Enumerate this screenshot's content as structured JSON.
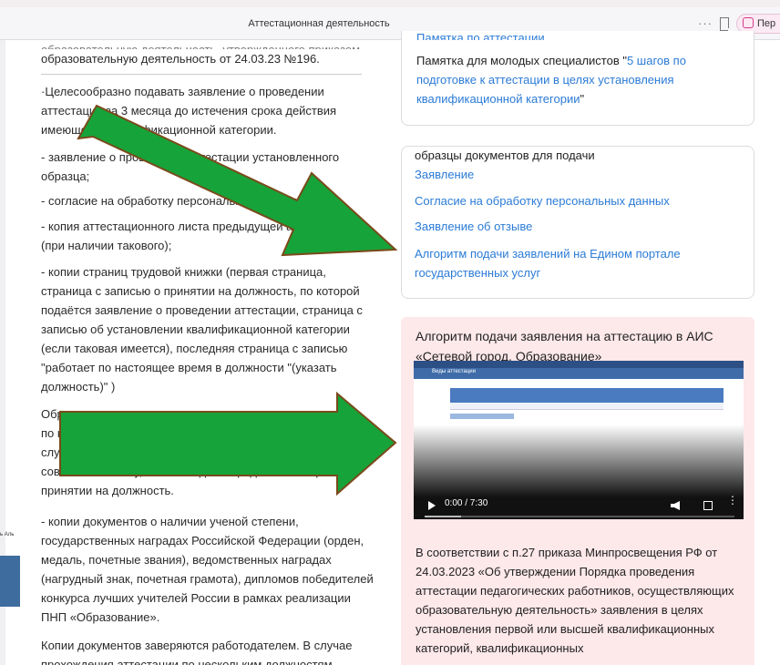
{
  "topbar": {
    "title": "Аттестационная деятельность",
    "menu": "···",
    "ext_label": "Пер"
  },
  "behind": {
    "text": "ь Аль"
  },
  "left": {
    "top_partial": "образовательную деятельность, утвержденного приказом",
    "order_line": "образовательную деятельность от 24.03.23 №196.",
    "para1": "·Целесообразно подавать заявление о проведении аттестации за 3 месяца до истечения срока действия имеющейся квалификационной категории.",
    "para2": "- заявление о проведении аттестации установленного образца;",
    "para3": "- согласие на обработку персональных данных;",
    "para4": "- копия аттестационного листа предыдущей аттестации (при наличии такового);",
    "para5": "- копии страниц трудовой книжки (первая страница, страница с записью о принятии на должность, по которой подаётся заявление о проведении аттестации, страница с записью об установлении квалификационной категории (если таковая имеется), последняя страница с записью \"работает по настоящее время в должности \"(указать должность)\" )",
    "para6": "Обратите внимание, занимаемая должность и должность по которой подаётся заявление должны совпадать. В случае, если Вы работаете по должности по совместительству, то необходимо предоставить приказ о принятии на должность.",
    "para7": "- копии документов о наличии ученой степени, государственных наградах Российской Федерации (орден, медаль, почетные звания), ведомственных наградах (нагрудный знак, почетная грамота), дипломов победителей конкурса лучших учителей России в рамках реализации ПНП «Образование».",
    "para8": "Копии документов заверяются работодателем. В случае прохождения аттестации по нескольким должностям"
  },
  "card1": {
    "partial": "Памятка по аттестации",
    "text_prefix": "Памятка для молодых специалистов \"",
    "link": "5 шагов по подготовке к аттестации в целях установления квалификационной категории",
    "text_suffix": "\""
  },
  "card2": {
    "heading": "образцы документов для подачи",
    "items": [
      "Заявление",
      "Согласие на обработку персональных данных",
      "Заявление об отзыве",
      "Алгоритм подачи заявлений на Едином портале государственных услуг"
    ]
  },
  "video_panel": {
    "title": "Алгоритм подачи заявления на аттестацию в АИС «Сетевой город. Образование»",
    "screen_header": "Виды аттестации",
    "time": "0:00 / 7:30",
    "progress": 0.0,
    "body": "В соответствии с п.27 приказа Минпросвещения РФ от 24.03.2023 «Об утверждении Порядка проведения аттестации педагогических работников, осуществляющих образовательную деятельность» заявления в целях установления первой или высшей квалификационных категорий, квалификационных"
  },
  "colors": {
    "link": "#2b7bd6",
    "panel_pink": "#fde8ea",
    "arrow_green": "#16a33a",
    "arrow_outline": "#7a4a1a"
  },
  "icons": [
    "bookmark-icon",
    "extension-icon",
    "play-icon",
    "volume-icon",
    "fullscreen-icon",
    "more-vert-icon"
  ]
}
